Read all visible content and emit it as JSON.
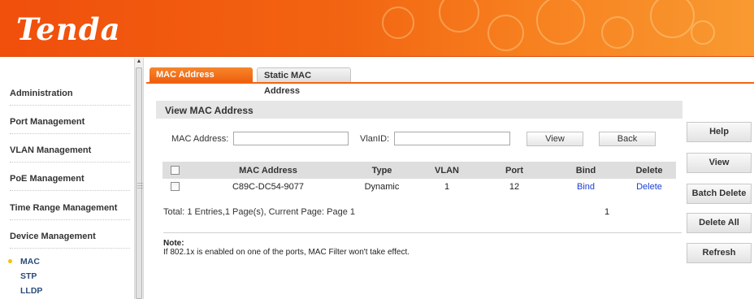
{
  "brand": {
    "logo_text": "Tenda",
    "accent": "#f26411"
  },
  "sidebar": {
    "items": [
      {
        "label": "Administration"
      },
      {
        "label": "Port Management"
      },
      {
        "label": "VLAN Management"
      },
      {
        "label": "PoE Management"
      },
      {
        "label": "Time Range Management"
      },
      {
        "label": "Device Management"
      }
    ],
    "sub_items": [
      {
        "label": "MAC",
        "selected": true
      },
      {
        "label": "STP",
        "selected": false
      },
      {
        "label": "LLDP",
        "selected": false
      }
    ]
  },
  "tabs": [
    {
      "label": "MAC Address Display",
      "active": true
    },
    {
      "label": "Static MAC Address",
      "active": false
    }
  ],
  "section": {
    "title": "View MAC Address"
  },
  "filter": {
    "mac_label": "MAC Address:",
    "mac_value": "",
    "vlan_label": "VlanID:",
    "vlan_value": "",
    "view_button": "View",
    "back_button": "Back"
  },
  "table": {
    "columns": [
      "MAC Address",
      "Type",
      "VLAN",
      "Port",
      "Bind",
      "Delete"
    ],
    "rows": [
      {
        "mac": "C89C-DC54-9077",
        "type": "Dynamic",
        "vlan": "1",
        "port": "12",
        "bind": "Bind",
        "delete": "Delete"
      }
    ]
  },
  "pagination": {
    "summary": "Total: 1 Entries,1 Page(s), Current Page: Page 1",
    "page": "1"
  },
  "note": {
    "title": "Note:",
    "text": "If 802.1x is enabled on one of the ports, MAC Filter won't take effect."
  },
  "actions": {
    "help": "Help",
    "view": "View",
    "batch_delete": "Batch Delete",
    "delete_all": "Delete All",
    "refresh": "Refresh"
  }
}
